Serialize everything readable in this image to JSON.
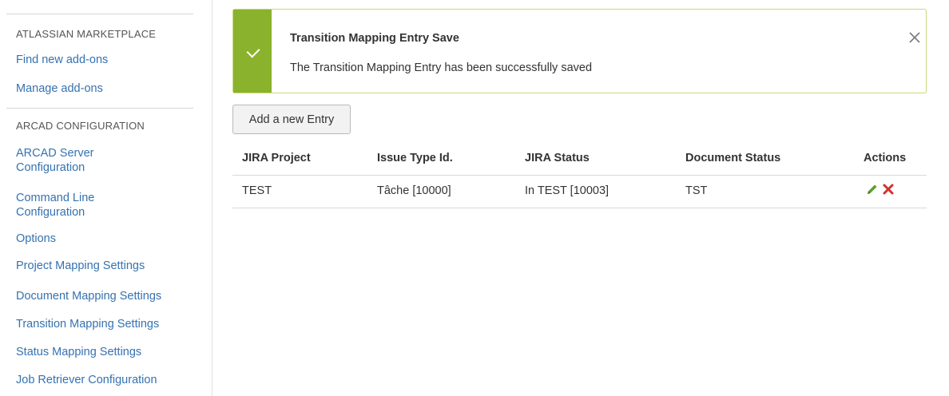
{
  "sidebar": {
    "marketplace_heading": "ATLASSIAN MARKETPLACE",
    "marketplace_links": [
      "Find new add-ons",
      "Manage add-ons"
    ],
    "arcad_heading": "ARCAD CONFIGURATION",
    "arcad_links": [
      "ARCAD Server\nConfiguration",
      "Command Line\nConfiguration",
      "Options",
      "Project Mapping Settings",
      "Document Mapping Settings",
      "Transition Mapping Settings",
      "Status Mapping Settings",
      "Job Retriever Configuration"
    ]
  },
  "flag": {
    "title": "Transition Mapping Entry Save",
    "message": "The Transition Mapping Entry has been successfully saved",
    "icon": "check-icon",
    "close_icon": "close-icon"
  },
  "toolbar": {
    "add_label": "Add a new Entry"
  },
  "table": {
    "headers": [
      "JIRA Project",
      "Issue Type Id.",
      "JIRA Status",
      "Document Status",
      "Actions"
    ],
    "rows": [
      {
        "project": "TEST",
        "issue_type": "Tâche [10000]",
        "jira_status": "In TEST [10003]",
        "document_status": "TST",
        "actions": [
          "edit-pencil-icon",
          "delete-x-icon"
        ]
      }
    ]
  },
  "colors": {
    "link": "#3572b0",
    "success": "#8bb22c",
    "edit": "#5aa02c",
    "delete": "#d0312d"
  }
}
